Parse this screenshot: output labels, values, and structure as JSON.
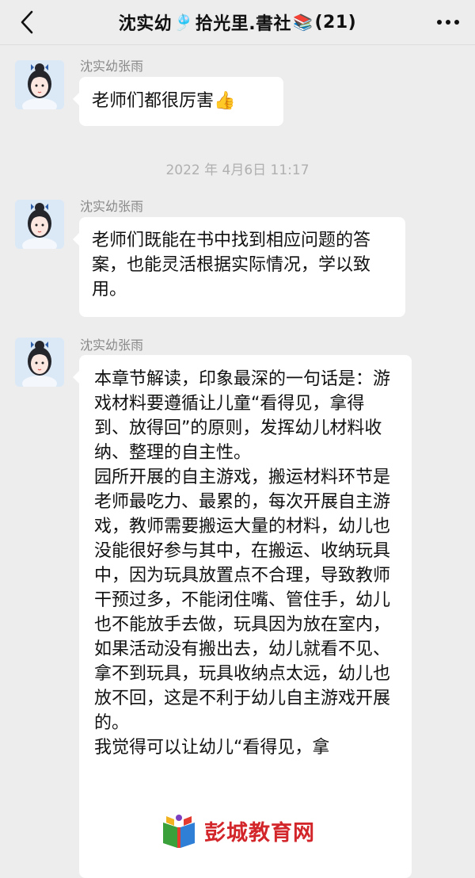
{
  "header": {
    "title_part1": "沈实幼",
    "title_emoji1": "🎐",
    "title_part2": "拾光里.書社",
    "title_emoji2": "📚",
    "member_count": "(21)"
  },
  "messages": [
    {
      "sender": "沈实幼张雨",
      "text": "老师们都很厉害",
      "emoji": "👍"
    },
    {
      "sender": "沈实幼张雨",
      "text": "老师们既能在书中找到相应问题的答案，也能灵活根据实际情况，学以致用。"
    },
    {
      "sender": "沈实幼张雨",
      "paragraph1": "本章节解读，印象最深的一句话是：游戏材料要遵循让儿童“看得见，拿得到、放得回”的原则，发挥幼儿材料收纳、整理的自主性。",
      "paragraph2": "园所开展的自主游戏，搬运材料环节是老师最吃力、最累的，每次开展自主游戏，教师需要搬运大量的材料，幼儿也没能很好参与其中，在搬运、收纳玩具中，因为玩具放置点不合理，导致教师干预过多，不能闭住嘴、管住手，幼儿也不能放手去做，玩具因为放在室内，如果活动没有搬出去，幼儿就看不见、拿不到玩具，玩具收纳点太远，幼儿也放不回，这是不利于幼儿自主游戏开展的。",
      "paragraph3": "我觉得可以让幼儿“看得见，拿"
    }
  ],
  "timestamp": "2022 年 4月6日 11:17",
  "watermark": {
    "text": "彭城教育网"
  },
  "colors": {
    "background": "#ededed",
    "bubble": "#ffffff",
    "sender": "#8a8a8a",
    "watermark": "#d2262b"
  },
  "icons": [
    "back-chevron-icon",
    "more-dots-icon",
    "thumbs-up-icon",
    "watermark-logo-icon"
  ]
}
